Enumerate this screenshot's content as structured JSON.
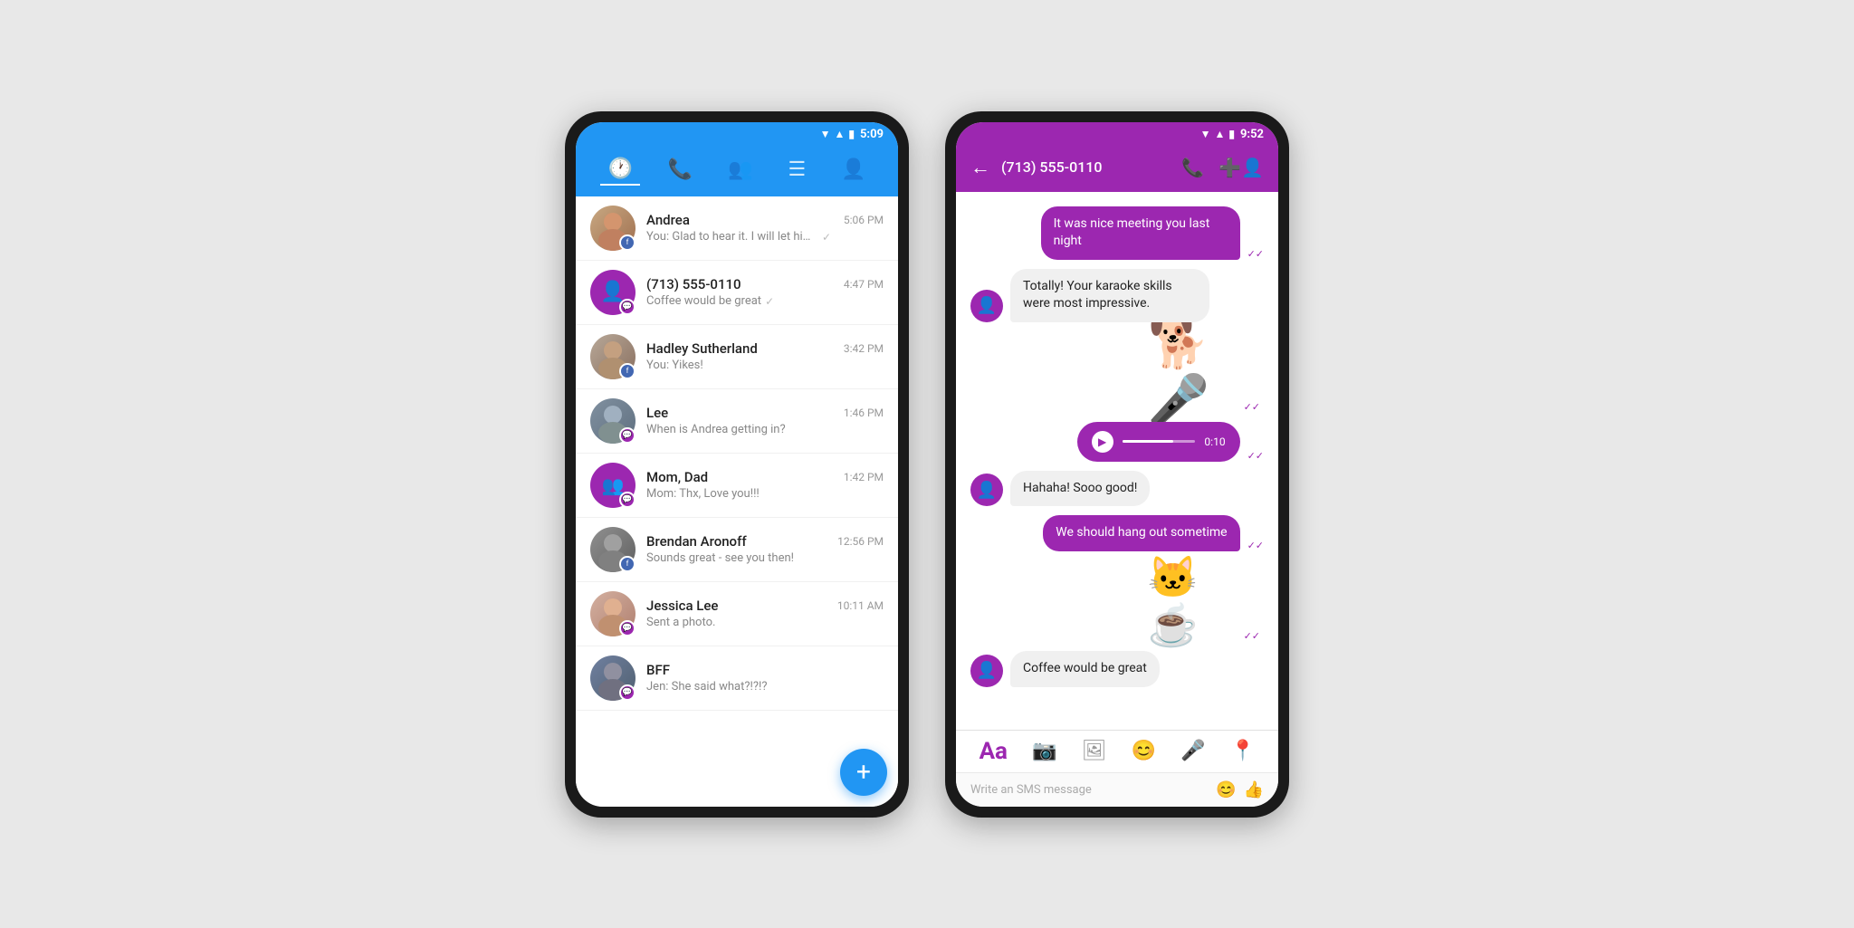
{
  "phone1": {
    "statusBar": {
      "time": "5:09",
      "icons": "wifi signal battery"
    },
    "tabs": [
      {
        "id": "recent",
        "icon": "🕐",
        "active": true
      },
      {
        "id": "phone",
        "icon": "📞",
        "active": false
      },
      {
        "id": "contacts",
        "icon": "👥",
        "active": false
      },
      {
        "id": "menu",
        "icon": "☰",
        "active": false
      },
      {
        "id": "account",
        "icon": "👤",
        "active": false
      }
    ],
    "contacts": [
      {
        "name": "Andrea",
        "time": "5:06 PM",
        "preview": "You: Glad to hear it. I will let him know..",
        "badge": "messenger",
        "hasCheck": true,
        "avatarType": "photo",
        "avatarColor": "#aaa"
      },
      {
        "name": "(713) 555-0110",
        "time": "4:47 PM",
        "preview": "Coffee would be great",
        "badge": "sms",
        "hasCheck": true,
        "avatarType": "icon",
        "avatarColor": "#9C27B0"
      },
      {
        "name": "Hadley Sutherland",
        "time": "3:42 PM",
        "preview": "You: Yikes!",
        "badge": "messenger",
        "hasCheck": false,
        "avatarType": "photo",
        "avatarColor": "#aaa"
      },
      {
        "name": "Lee",
        "time": "1:46 PM",
        "preview": "When is Andrea getting in?",
        "badge": "sms",
        "hasCheck": false,
        "avatarType": "photo",
        "avatarColor": "#aaa"
      },
      {
        "name": "Mom, Dad",
        "time": "1:42 PM",
        "preview": "Mom: Thx, Love you!!!",
        "badge": "sms",
        "hasCheck": false,
        "avatarType": "icon",
        "avatarColor": "#9C27B0"
      },
      {
        "name": "Brendan Aronoff",
        "time": "12:56 PM",
        "preview": "Sounds great - see you then!",
        "badge": "messenger",
        "hasCheck": false,
        "avatarType": "photo",
        "avatarColor": "#aaa"
      },
      {
        "name": "Jessica Lee",
        "time": "10:11 AM",
        "preview": "Sent a photo.",
        "badge": "sms",
        "hasCheck": false,
        "avatarType": "photo",
        "avatarColor": "#aaa"
      },
      {
        "name": "BFF",
        "time": "",
        "preview": "Jen: She said what?!?!?",
        "badge": "sms",
        "hasCheck": false,
        "avatarType": "photo",
        "avatarColor": "#aaa"
      }
    ],
    "fab": "+"
  },
  "phone2": {
    "statusBar": {
      "time": "9:52"
    },
    "header": {
      "title": "(713) 555-0110",
      "backIcon": "←",
      "callIcon": "📞",
      "addIcon": "➕"
    },
    "messages": [
      {
        "type": "sent",
        "text": "It was nice meeting you last night",
        "check": "✓✓"
      },
      {
        "type": "received",
        "text": "Totally! Your karaoke skills were most impressive.",
        "check": ""
      },
      {
        "type": "sticker-sent",
        "emoji": "🎤",
        "check": "✓✓"
      },
      {
        "type": "audio-sent",
        "duration": "0:10",
        "check": "✓✓"
      },
      {
        "type": "received",
        "text": "Hahaha! Sooo good!",
        "check": ""
      },
      {
        "type": "sent",
        "text": "We should hang out sometime",
        "check": "✓✓"
      },
      {
        "type": "sticker-sent-coffee",
        "emoji": "☕",
        "check": "✓✓"
      },
      {
        "type": "received",
        "text": "Coffee would be great",
        "check": ""
      }
    ],
    "inputBar": {
      "icons": [
        "Aa",
        "📷",
        "🖼",
        "😊",
        "🎤",
        "📍"
      ]
    },
    "smsBar": {
      "placeholder": "Write an SMS message",
      "icons": [
        "😊",
        "👍"
      ]
    }
  }
}
